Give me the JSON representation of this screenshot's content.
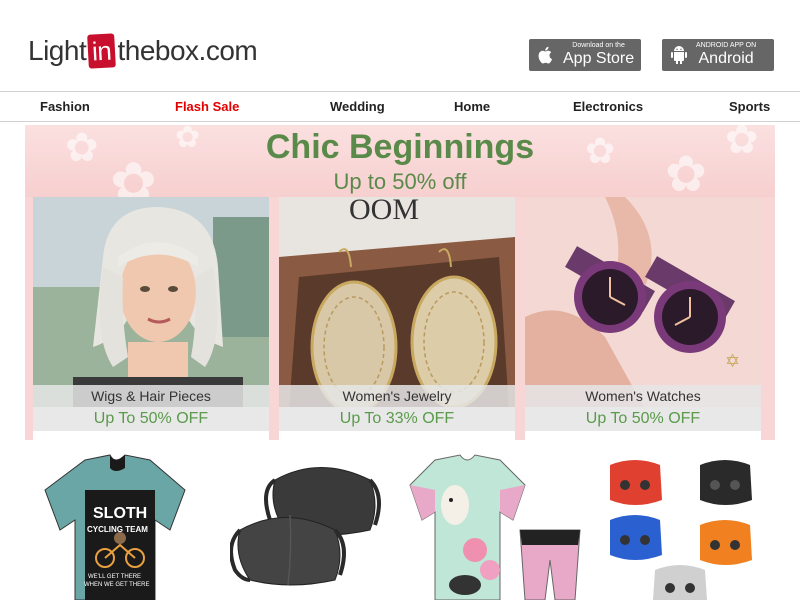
{
  "header": {
    "logo": {
      "prefix": "Light",
      "in": "in",
      "suffix": "thebox.com"
    },
    "appstore": {
      "small": "Download on the",
      "big": "App Store"
    },
    "android": {
      "small": "ANDROID APP ON",
      "big": "Android"
    }
  },
  "nav": {
    "items": [
      "Fashion",
      "Flash Sale",
      "Wedding",
      "Home",
      "Electronics",
      "Sports"
    ]
  },
  "banner": {
    "title": "Chic Beginnings",
    "subtitle": "Up to 50% off",
    "cards": [
      {
        "label": "Wigs & Hair Pieces",
        "offer": "Up To 50% OFF"
      },
      {
        "label": "Women's Jewelry",
        "offer": "Up To 33% OFF"
      },
      {
        "label": "Women's Watches",
        "offer": "Up To 50% OFF"
      }
    ]
  },
  "products": {
    "jersey_text": {
      "line1": "SLOTH",
      "line2": "CYCLING TEAM",
      "line3": "WE'LL GET THERE",
      "line4": "WHEN WE GET THERE"
    }
  },
  "colors": {
    "accent_red": "#e30000",
    "brand_red": "#c8102e",
    "offer_green": "#5a9a4a",
    "banner_pink": "#f9d6d6"
  }
}
